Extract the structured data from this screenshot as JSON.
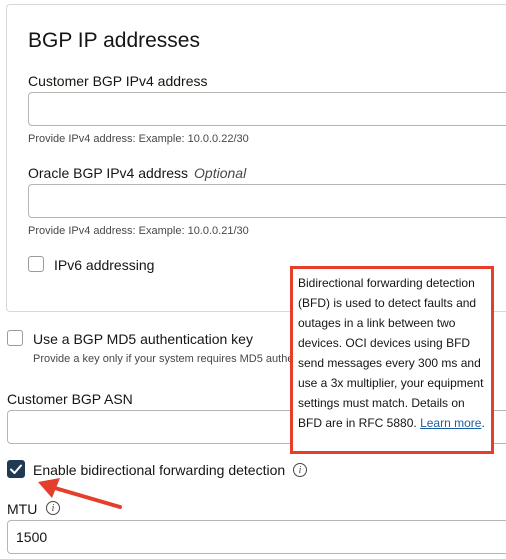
{
  "bgp": {
    "title": "BGP IP addresses",
    "customer_ipv4_label": "Customer BGP IPv4 address",
    "customer_ipv4_value": "",
    "customer_ipv4_help": "Provide IPv4 address: Example: 10.0.0.22/30",
    "oracle_ipv4_label": "Oracle BGP IPv4 address",
    "oracle_ipv4_optional": "Optional",
    "oracle_ipv4_value": "",
    "oracle_ipv4_help": "Provide IPv4 address: Example: 10.0.0.21/30",
    "ipv6_label": "IPv6 addressing",
    "ipv6_checked": false
  },
  "md5": {
    "label": "Use a BGP MD5 authentication key",
    "help": "Provide a key only if your system requires MD5 authe",
    "checked": false
  },
  "asn": {
    "label": "Customer BGP ASN",
    "value": ""
  },
  "bfd": {
    "label": "Enable bidirectional forwarding detection",
    "checked": true,
    "tooltip_text": "Bidirectional forwarding detection (BFD) is used to detect faults and outages in a link between two devices. OCI devices using BFD send messages every 300 ms and use a 3x multiplier, your equipment settings must match. Details on BFD are in RFC 5880.",
    "tooltip_link": "Learn more",
    "tooltip_end": "."
  },
  "mtu": {
    "label": "MTU",
    "value": "1500"
  },
  "colors": {
    "annotation_red": "#e53e2b",
    "checkbox_checked": "#1f3a52",
    "link": "#1a5fa5"
  },
  "icons": [
    "check-icon",
    "info-icon",
    "arrow-annotation"
  ]
}
